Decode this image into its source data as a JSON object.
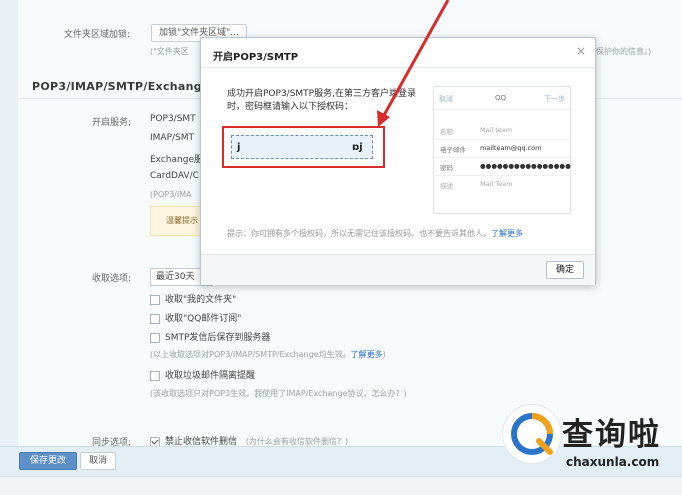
{
  "folder_sync": {
    "label": "文件夹区域加锁:",
    "button": "加锁\"文件夹区域\"...",
    "note_left": "(\"文件夹区",
    "note_right": "保护你的信息。)"
  },
  "protocols": {
    "section_title": "POP3/IMAP/SMTP/Exchange",
    "open_label": "开启服务:",
    "items": [
      "POP3/SMT",
      "IMAP/SMT",
      "Exchange服",
      "CardDAV/C"
    ],
    "note": "(POP3/IMA",
    "hint": "温馨提示"
  },
  "receive": {
    "label": "收取选项:",
    "select_value": "最近30天",
    "options": [
      {
        "label": "收取\"我的文件夹\"",
        "checked": false
      },
      {
        "label": "收取\"QQ邮件订阅\"",
        "checked": false
      },
      {
        "label": "SMTP发信后保存到服务器",
        "checked": false
      }
    ],
    "note1": "(以上收取选项对POP3/IMAP/SMTP/Exchange均生效。",
    "note1_link": "了解更多",
    "note1_end": ")",
    "junk_option": {
      "label": "收取垃圾邮件隔离提醒",
      "checked": false
    },
    "note2": "(该收取选项只对POP3生效。我使用了IMAP/Exchange协议，怎么办？)"
  },
  "sync": {
    "label": "同步选项:",
    "option": "禁止收信软件删信",
    "option_note": "(为什么会有收信软件删信？)"
  },
  "actions": {
    "save": "保存更改",
    "cancel": "取消"
  },
  "dialog": {
    "title": "开启POP3/SMTP",
    "close": "×",
    "message": "成功开启POP3/SMTP服务,在第三方客户端登录时，密码框请输入以下授权码：",
    "code_left": "j",
    "code_right": "ɒj",
    "phone": {
      "cancel": "取消",
      "title": "QQ",
      "next": "下一步",
      "rows": [
        {
          "k": "名称",
          "v": "Mail team"
        },
        {
          "k": "电子邮件",
          "v": "mailteam@qq.com"
        },
        {
          "k": "密码",
          "v": "●●●●●●●●●●●●●●●●"
        },
        {
          "k": "描述",
          "v": "Mail Team"
        }
      ]
    },
    "tip": "提示：你可拥有多个授权码，所以无需记住该授权码。也不要告诉其他人。",
    "tip_link": "了解更多",
    "ok": "确定"
  },
  "watermark": {
    "name": "查询啦",
    "domain": "chaxunla.com"
  },
  "colors": {
    "accent": "#5d90c8",
    "highlight": "#d92b2b",
    "link": "#2a6dc4"
  }
}
